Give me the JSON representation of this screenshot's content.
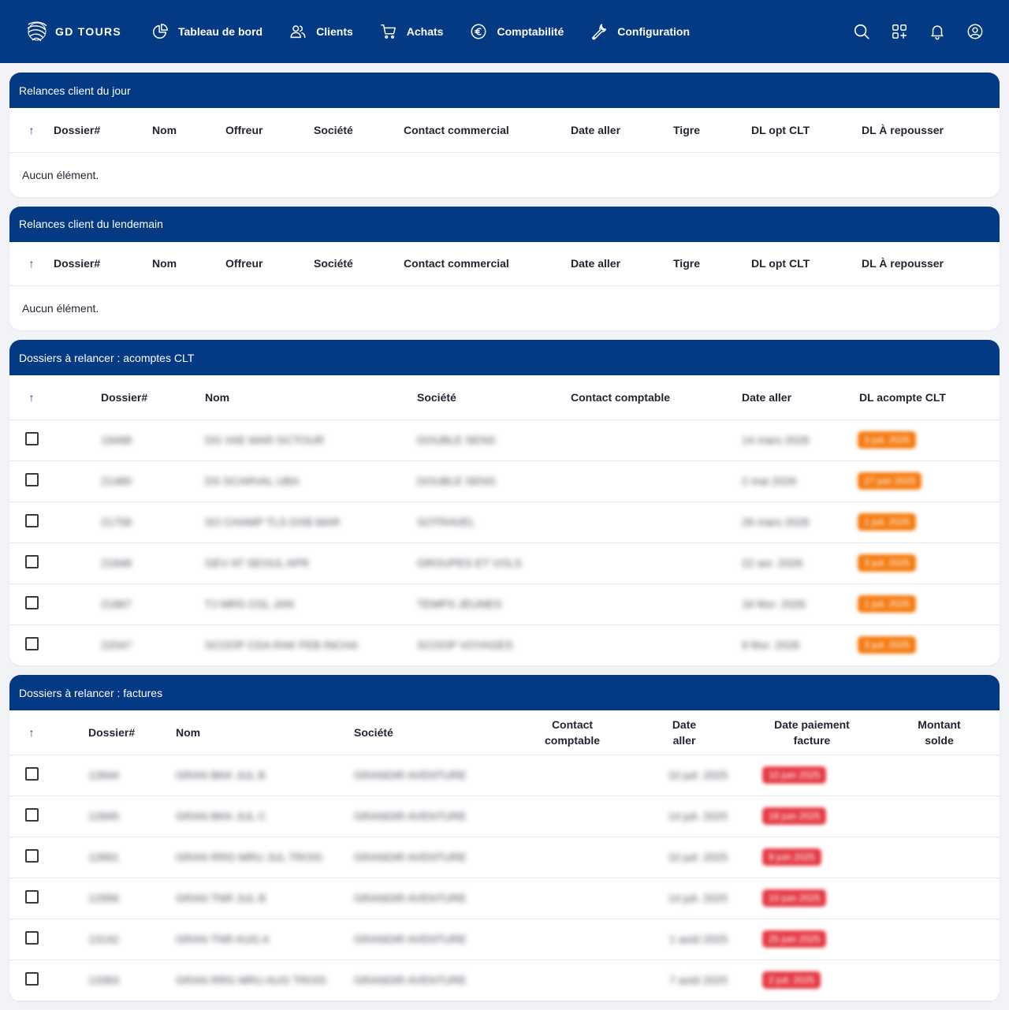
{
  "brand": {
    "name": "GD TOURS",
    "logo": "gd-tours-logo"
  },
  "nav": {
    "items": [
      {
        "label": "Tableau de bord",
        "icon": "pie-chart-icon"
      },
      {
        "label": "Clients",
        "icon": "users-icon"
      },
      {
        "label": "Achats",
        "icon": "cart-icon"
      },
      {
        "label": "Comptabilité",
        "icon": "euro-icon"
      },
      {
        "label": "Configuration",
        "icon": "wrench-icon"
      }
    ],
    "right_icons": [
      "search-icon",
      "apps-icon",
      "bell-icon",
      "user-circle-icon"
    ]
  },
  "colors": {
    "navbar": "#043984",
    "badge_orange": "#f57c12",
    "badge_red": "#e53b45"
  },
  "sections": {
    "relances_jour": {
      "title": "Relances client du jour",
      "columns": [
        "Dossier#",
        "Nom",
        "Offreur",
        "Société",
        "Contact commercial",
        "Date aller",
        "Tigre",
        "DL opt CLT",
        "DL À repousser"
      ],
      "empty": "Aucun élément."
    },
    "relances_lendemain": {
      "title": "Relances client du lendemain",
      "columns": [
        "Dossier#",
        "Nom",
        "Offreur",
        "Société",
        "Contact commercial",
        "Date aller",
        "Tigre",
        "DL opt CLT",
        "DL À repousser"
      ],
      "empty": "Aucun élément."
    },
    "acomptes": {
      "title": "Dossiers à relancer : acomptes CLT",
      "columns": [
        "Dossier#",
        "Nom",
        "Société",
        "Contact comptable",
        "Date aller",
        "DL acompte CLT"
      ],
      "rows": [
        {
          "dossier": "19498",
          "nom": "DG VAE MAR GCTOUR",
          "societe": "DOUBLE SENS",
          "contact": "",
          "date_aller": "14 mars 2026",
          "dl": "3 juil. 2025"
        },
        {
          "dossier": "21480",
          "nom": "DS SCARVAL UBA",
          "societe": "DOUBLE SENS",
          "contact": "",
          "date_aller": "2 mai 2026",
          "dl": "27 juin 2025"
        },
        {
          "dossier": "21758",
          "nom": "SO CHAMP TLS DXB MAR",
          "societe": "SOTRAVEL",
          "contact": "",
          "date_aller": "26 mars 2026",
          "dl": "1 juil. 2025"
        },
        {
          "dossier": "21848",
          "nom": "GEV AT SEOUL APR",
          "societe": "GROUPES ET VOLS",
          "contact": "",
          "date_aller": "22 avr. 2026",
          "dl": "3 juil. 2025"
        },
        {
          "dossier": "21867",
          "nom": "TJ MRS CGL JAN",
          "societe": "TEMPS JEUNES",
          "contact": "",
          "date_aller": "16 févr. 2026",
          "dl": "1 juil. 2025"
        },
        {
          "dossier": "22047",
          "nom": "SCOOP CDA RAK FEB INCHA",
          "societe": "SCOOP VOYAGES",
          "contact": "",
          "date_aller": "9 févr. 2026",
          "dl": "3 juil. 2025"
        }
      ]
    },
    "factures": {
      "title": "Dossiers à relancer : factures",
      "columns": [
        "Dossier#",
        "Nom",
        "Société",
        "Contact comptable",
        "Date aller",
        "Date paiement facture",
        "Montant solde"
      ],
      "rows": [
        {
          "dossier": "12844",
          "nom": "GRAN BKK JUL B",
          "societe": "GRANDIR AVENTURE",
          "contact": "",
          "date_aller": "10 juil. 2025",
          "date_paiement": "10 juin 2025",
          "montant": ""
        },
        {
          "dossier": "12845",
          "nom": "GRAN BKK JUL C",
          "societe": "GRANDIR AVENTURE",
          "contact": "",
          "date_aller": "14 juil. 2025",
          "date_paiement": "18 juin 2025",
          "montant": ""
        },
        {
          "dossier": "12891",
          "nom": "GRAN RRG MRU JUL TROIS",
          "societe": "GRANDIR AVENTURE",
          "contact": "",
          "date_aller": "10 juil. 2025",
          "date_paiement": "9 juin 2025",
          "montant": ""
        },
        {
          "dossier": "12956",
          "nom": "GRAN TNR JUL B",
          "societe": "GRANDIR AVENTURE",
          "contact": "",
          "date_aller": "14 juil. 2025",
          "date_paiement": "10 juin 2025",
          "montant": ""
        },
        {
          "dossier": "13142",
          "nom": "GRAN TNR AUG A",
          "societe": "GRANDIR AVENTURE",
          "contact": "",
          "date_aller": "1 août 2025",
          "date_paiement": "25 juin 2025",
          "montant": ""
        },
        {
          "dossier": "13363",
          "nom": "GRAN RRG MRU AUG TROIS",
          "societe": "GRANDIR AVENTURE",
          "contact": "",
          "date_aller": "7 août 2025",
          "date_paiement": "2 juil. 2025",
          "montant": ""
        }
      ]
    }
  }
}
